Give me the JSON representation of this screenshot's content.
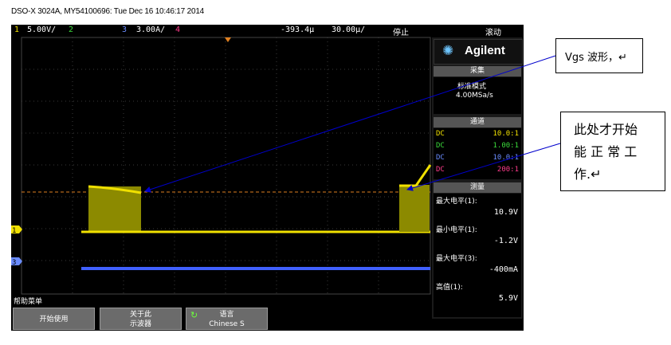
{
  "window": {
    "title": "DSO-X 3024A, MY54100696: Tue Dec 16 10:46:17 2014"
  },
  "topbar": {
    "ch1_num": "1",
    "ch1_scale": "5.00V/",
    "ch2_num": "2",
    "ch3_num": "3",
    "ch3_scale": "3.00A/",
    "ch4_num": "4",
    "delay": "-393.4µ",
    "timebase": "30.00µ/",
    "run_state": "停止",
    "trigger_mode": "滚动"
  },
  "panel": {
    "brand": "Agilent",
    "acquire": {
      "header": "采集",
      "mode": "标准模式",
      "rate": "4.00MSa/s"
    },
    "channels": {
      "header": "通道",
      "rows": [
        {
          "coupling": "DC",
          "probe": "10.0:1",
          "color": "#f0e000"
        },
        {
          "coupling": "DC",
          "probe": "1.00:1",
          "color": "#3cdc3c"
        },
        {
          "coupling": "DC",
          "probe": "10.0:1",
          "color": "#6a8cff"
        },
        {
          "coupling": "DC",
          "probe": "200:1",
          "color": "#ff3c8c"
        }
      ]
    },
    "measure": {
      "header": "测量",
      "items": [
        {
          "label": "最大电平(1):",
          "value": "10.9V"
        },
        {
          "label": "最小电平(1):",
          "value": "-1.2V"
        },
        {
          "label": "最大电平(3):",
          "value": "-400mA"
        },
        {
          "label": "高值(1):",
          "value": "5.9V"
        }
      ]
    }
  },
  "bottom": {
    "help_menu": "帮助菜单",
    "btn_start": "开始使用",
    "btn_about_1": "关于此",
    "btn_about_2": "示波器",
    "btn_lang_1": "语言",
    "btn_lang_2": "Chinese S"
  },
  "markers": {
    "ch1": "1",
    "ch3": "3"
  },
  "callouts": {
    "vgs": "Vgs 波形，↵",
    "normal_line1": "此处才开始",
    "normal_line2": "能 正 常 工",
    "normal_line3": "作.↵"
  },
  "colors": {
    "ch1": "#f0e000",
    "ch3": "#4060ff",
    "trigger": "#e08020",
    "annotation_arrow": "#0000cc"
  }
}
